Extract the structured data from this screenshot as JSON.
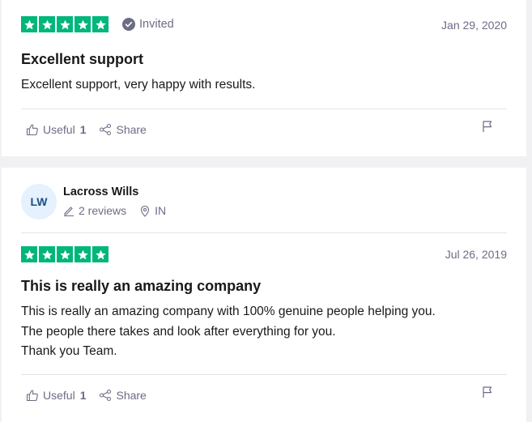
{
  "review1": {
    "rating": 5,
    "invited_label": "Invited",
    "date": "Jan 29, 2020",
    "title": "Excellent support",
    "body": [
      "Excellent support, very happy with results."
    ],
    "useful_label": "Useful",
    "useful_count": "1",
    "share_label": "Share"
  },
  "review2": {
    "reviewer": {
      "initials": "LW",
      "name": "Lacross Wills",
      "reviews": "2 reviews",
      "country": "IN"
    },
    "rating": 5,
    "date": "Jul 26, 2019",
    "title": "This is really an amazing company",
    "body": [
      "This is really an amazing company with 100% genuine people helping you.",
      "The people there takes and look after everything for you.",
      "Thank you Team."
    ],
    "useful_label": "Useful",
    "useful_count": "1",
    "share_label": "Share"
  },
  "colors": {
    "star_green": "#00b67a",
    "muted_text": "#6c6c85",
    "avatar_bg": "#e5f1fc",
    "avatar_text": "#1c4e86"
  }
}
